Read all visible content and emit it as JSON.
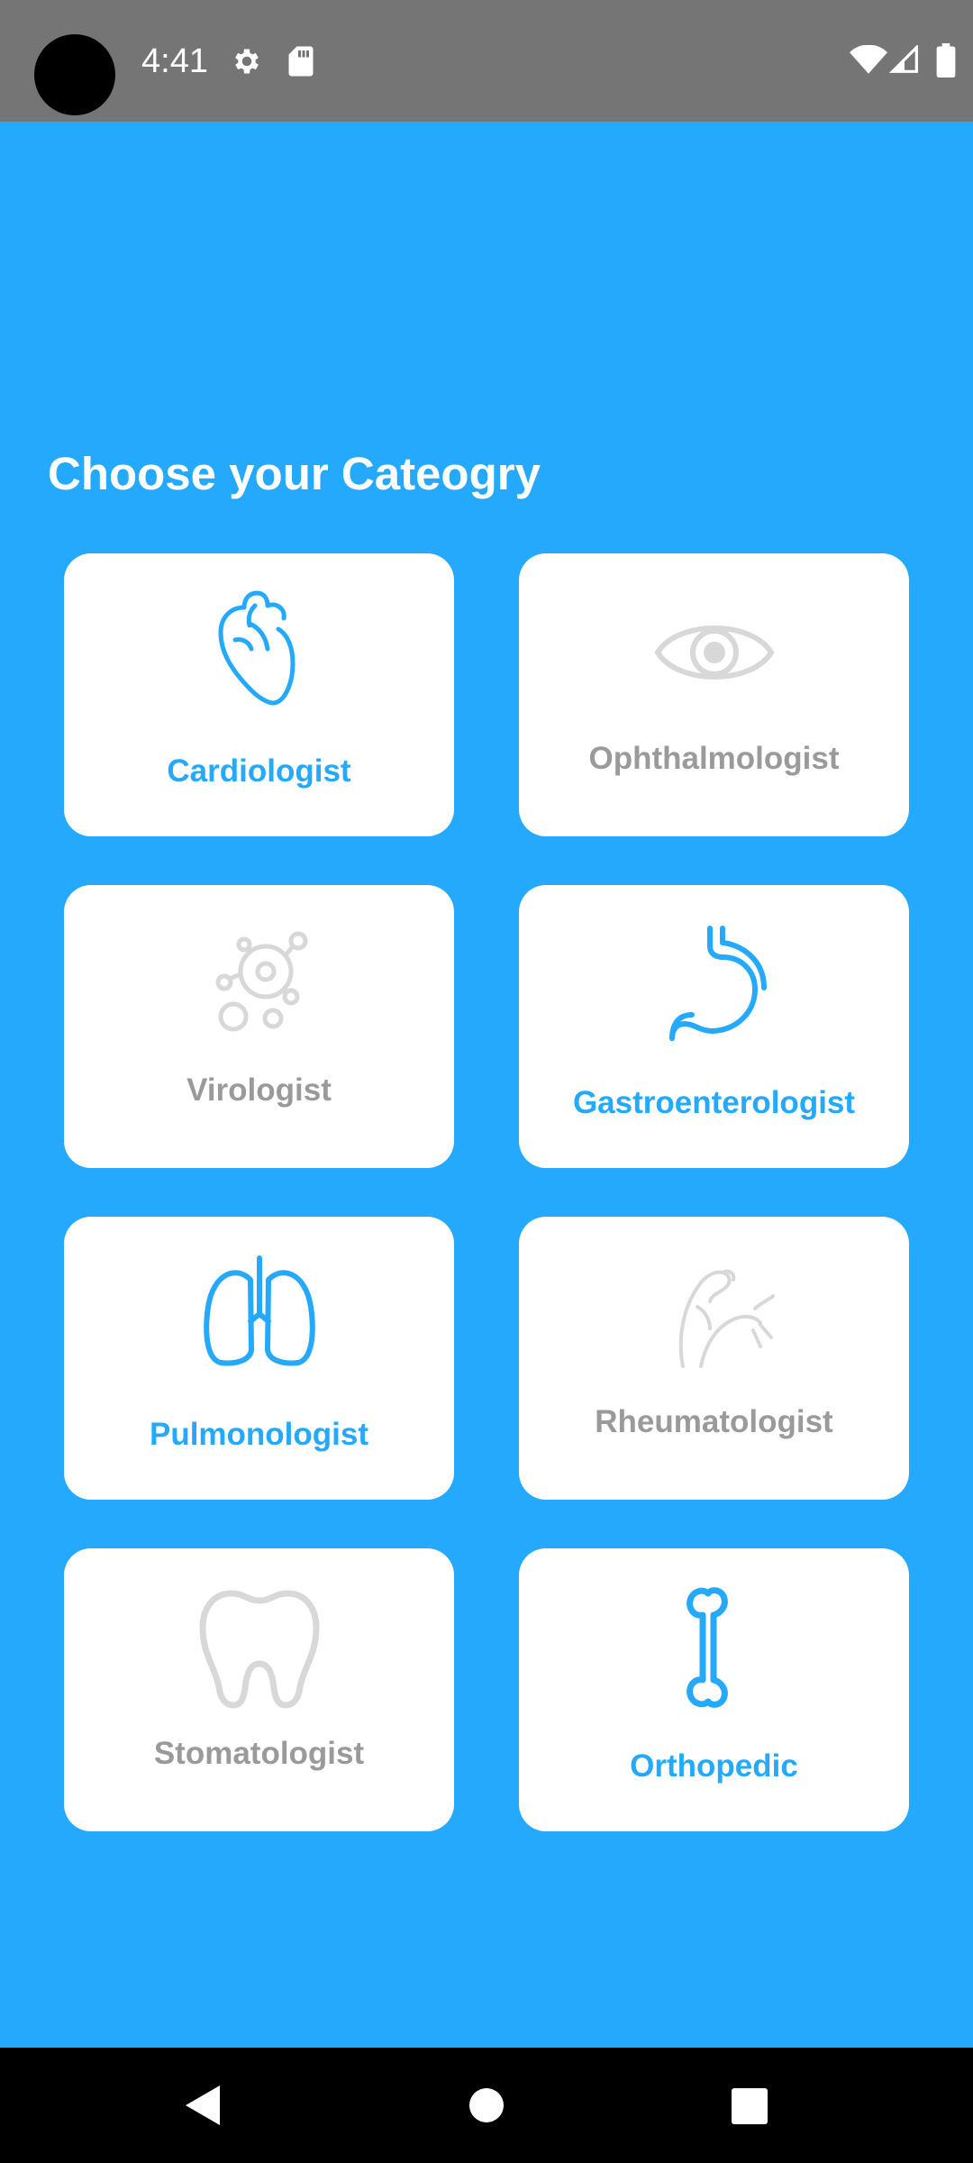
{
  "status_bar": {
    "time": "4:41",
    "icons": [
      "gear-icon",
      "sdcard-icon",
      "wifi-icon",
      "signal-icon",
      "battery-icon"
    ]
  },
  "main": {
    "title": "Choose your Cateogry"
  },
  "categories": [
    {
      "label": "Cardiologist",
      "icon": "heart-icon",
      "state": "active"
    },
    {
      "label": "Ophthalmologist",
      "icon": "eye-icon",
      "state": "inactive"
    },
    {
      "label": "Virologist",
      "icon": "virus-icon",
      "state": "inactive"
    },
    {
      "label": "Gastroenterologist",
      "icon": "stomach-icon",
      "state": "active"
    },
    {
      "label": "Pulmonologist",
      "icon": "lungs-icon",
      "state": "active"
    },
    {
      "label": "Rheumatologist",
      "icon": "arm-icon",
      "state": "inactive"
    },
    {
      "label": "Stomatologist",
      "icon": "tooth-icon",
      "state": "inactive"
    },
    {
      "label": "Orthopedic",
      "icon": "bone-icon",
      "state": "active"
    }
  ],
  "colors": {
    "background": "#25a9fc",
    "status_bar": "#757575",
    "active": "#25a9fc",
    "inactive_text": "#9a9a9a",
    "inactive_icon": "#d8d8d8"
  },
  "nav_bar": {
    "buttons": [
      "back-icon",
      "home-icon",
      "recents-icon"
    ]
  }
}
